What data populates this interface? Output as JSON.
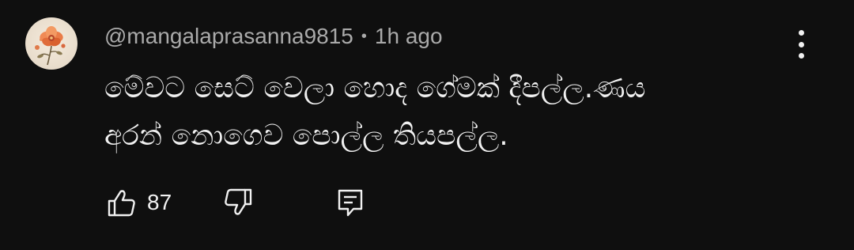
{
  "comment": {
    "author": "@mangalaprasanna9815",
    "separator": "•",
    "time": "1h ago",
    "text_lines": [
      "මේවට සෙට් වෙලා හොද ගේමක් දීපල්ල.ණය",
      "අරන් නොගෙව පොල්ල තියපල්ල."
    ],
    "like_count": "87"
  },
  "icons": {
    "like": "thumbs-up-icon",
    "dislike": "thumbs-down-icon",
    "reply": "reply-comment-icon",
    "more": "more-vertical-icon"
  },
  "colors": {
    "background": "#0f0f0f",
    "primary_text": "#f1f1f1",
    "secondary_text": "#aaaaaa"
  }
}
